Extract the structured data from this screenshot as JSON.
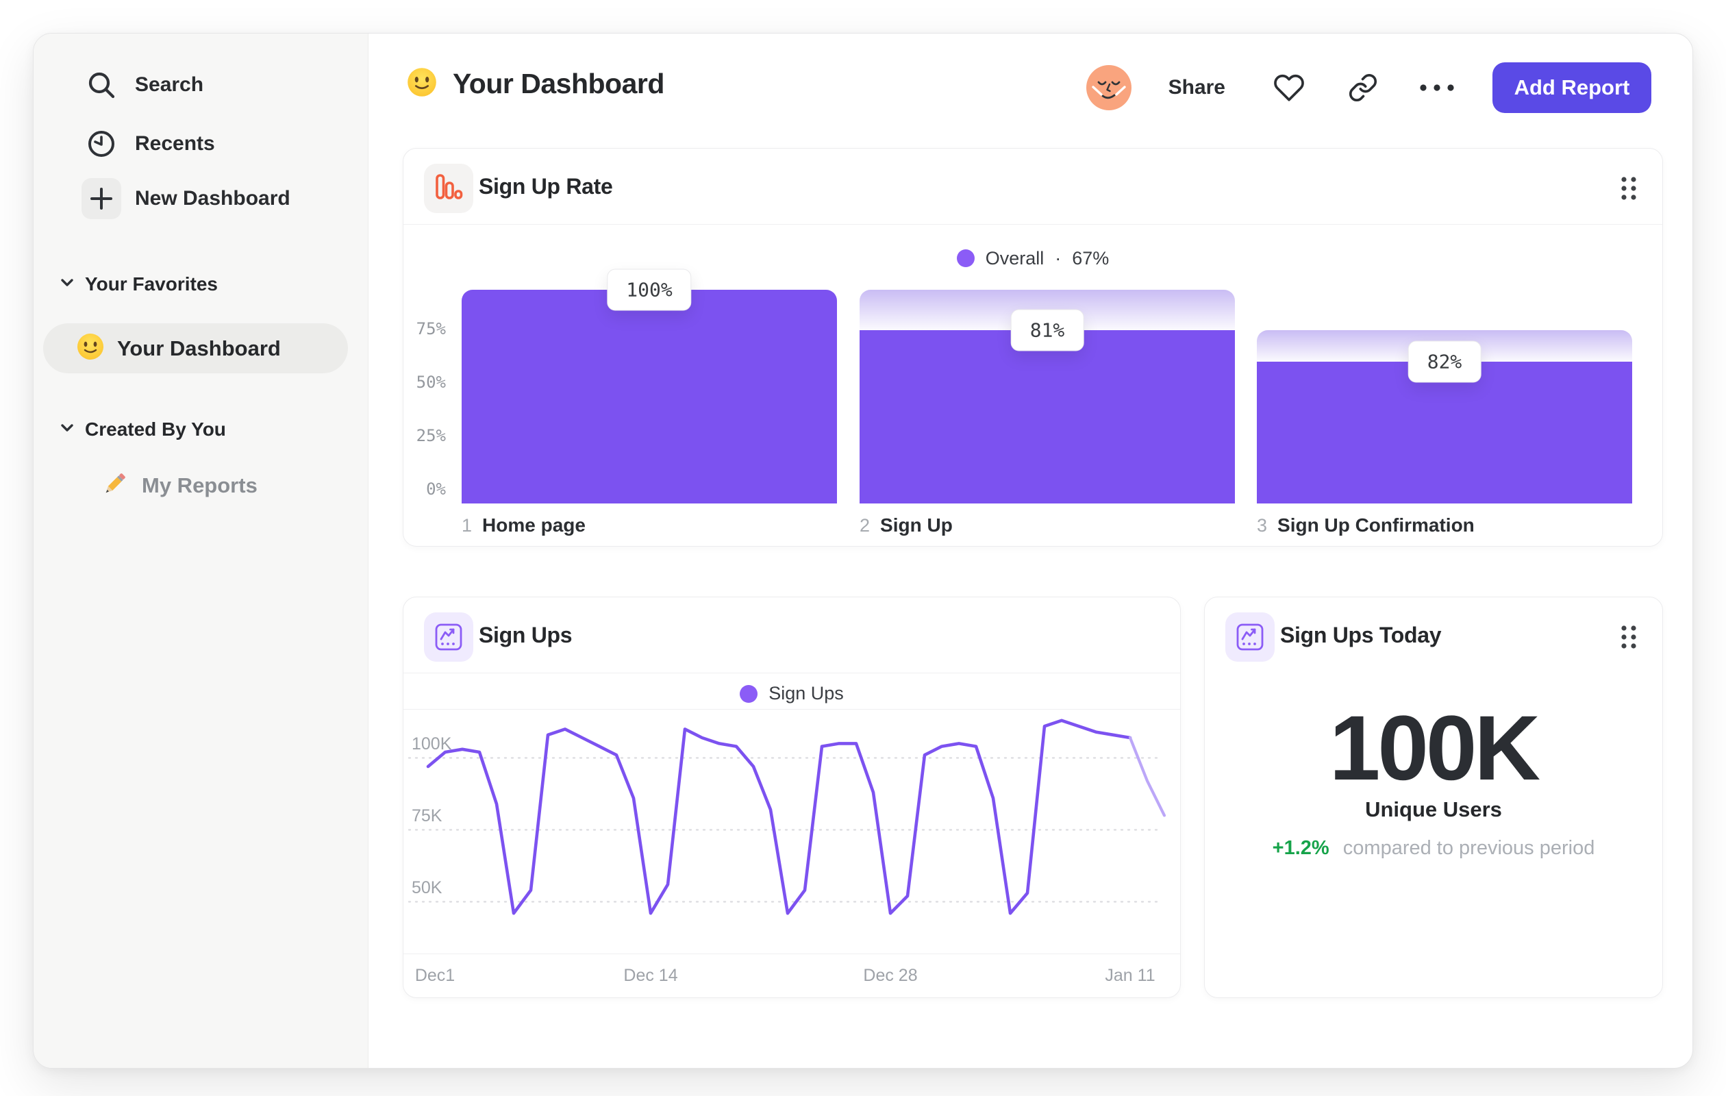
{
  "app": {
    "header": {
      "title_emoji": "slightly-smiling-face",
      "title": "Your Dashboard",
      "share_label": "Share",
      "add_report_label": "Add Report"
    },
    "sidebar": {
      "nav": [
        {
          "icon": "search-icon",
          "label": "Search"
        },
        {
          "icon": "clock-icon",
          "label": "Recents"
        },
        {
          "icon": "plus-icon",
          "label": "New Dashboard"
        }
      ],
      "sections": [
        {
          "label": "Your Favorites",
          "items": [
            {
              "emoji": "slightly-smiling-face",
              "label": "Your Dashboard",
              "selected": true
            }
          ]
        },
        {
          "label": "Created By You",
          "items": [
            {
              "emoji": "pencil",
              "label": "My Reports",
              "selected": false
            }
          ]
        }
      ]
    }
  },
  "colors": {
    "accent_purple": "#7c52f0",
    "accent_purple_light": "#bca7f8",
    "legend_dot": "#8b5cf6",
    "bar_gradient_top": "#c9bcf4",
    "bar_gradient_bottom": "#fbfafe",
    "button_indigo": "#5a4ae6",
    "positive_green": "#16a34a",
    "funnel_icon_orange": "#f2603f",
    "avatar_salmon": "#f9a47e",
    "sidebar_bg": "#f7f7f6"
  },
  "chart_data": [
    {
      "id": "signup_rate",
      "type": "bar",
      "title": "Sign Up Rate",
      "legend": {
        "series": "Overall",
        "separator": "·",
        "value_label": "67%"
      },
      "categories": [
        "Home page",
        "Sign Up",
        "Sign Up Confirmation"
      ],
      "step_numbers": [
        "1",
        "2",
        "3"
      ],
      "values_pct_of_previous": [
        100,
        81,
        82
      ],
      "values_pct_absolute": [
        100,
        81,
        66.4
      ],
      "bar_labels": [
        "100%",
        "81%",
        "82%"
      ],
      "y_ticks": [
        {
          "label": "75%",
          "value": 75
        },
        {
          "label": "50%",
          "value": 50
        },
        {
          "label": "25%",
          "value": 25
        },
        {
          "label": "0%",
          "value": 0
        }
      ],
      "ylim": [
        0,
        100
      ],
      "grid": "off",
      "legend_position": "top-center"
    },
    {
      "id": "signups_trend",
      "type": "line",
      "title": "Sign Ups",
      "legend": {
        "series": "Sign Ups"
      },
      "x_ticks": [
        {
          "label": "Dec1",
          "day": 0
        },
        {
          "label": "Dec 14",
          "day": 13
        },
        {
          "label": "Dec 28",
          "day": 27
        },
        {
          "label": "Jan 11",
          "day": 41
        }
      ],
      "y_ticks": [
        {
          "label": "100K",
          "value": 100
        },
        {
          "label": "75K",
          "value": 75
        },
        {
          "label": "50K",
          "value": 50
        }
      ],
      "values_k": [
        97,
        102,
        103,
        102,
        84,
        46,
        54,
        108,
        110,
        107,
        104,
        101,
        86,
        46,
        56,
        110,
        107,
        105,
        104,
        97,
        82,
        46,
        54,
        104,
        105,
        105,
        88,
        46,
        52,
        101,
        104,
        105,
        104,
        86,
        46,
        53,
        111,
        113,
        111,
        109,
        108,
        107,
        92,
        80
      ],
      "faded_from_index": 41,
      "ylim": [
        32,
        117
      ],
      "grid": "dashed-horizontal",
      "legend_position": "top-center"
    },
    {
      "id": "signups_today",
      "type": "stat",
      "title": "Sign Ups Today",
      "value": "100K",
      "value_label": "Unique Users",
      "change": "+1.2%",
      "change_note": "compared to previous period",
      "change_direction": "up"
    }
  ]
}
